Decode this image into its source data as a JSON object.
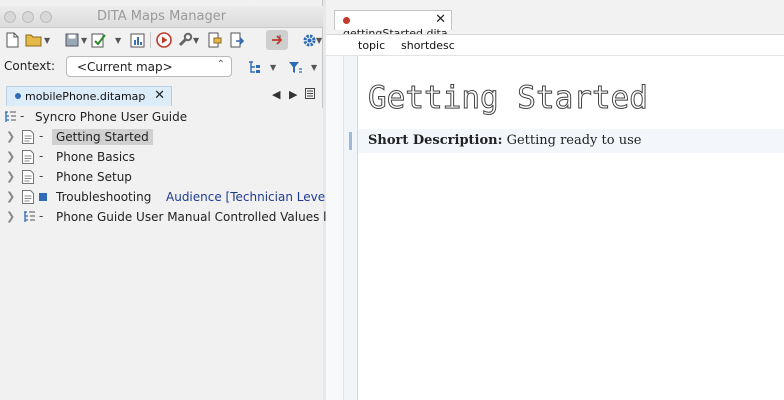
{
  "window": {
    "title": "DITA Maps Manager"
  },
  "context": {
    "label": "Context:",
    "value": "<Current map>"
  },
  "map_tab": {
    "name": "mobilePhone.ditamap",
    "close": "✕"
  },
  "tree": {
    "root": "Syncro Phone User Guide",
    "items": [
      {
        "label": "Getting Started",
        "selected": true
      },
      {
        "label": "Phone Basics"
      },
      {
        "label": "Phone Setup"
      },
      {
        "label": "Troubleshooting",
        "audience": "Audience [Technician Level]"
      },
      {
        "label": "Phone Guide User Manual Controlled Values list"
      }
    ],
    "dash": "-"
  },
  "editor": {
    "tab_name": "gettingStarted.dita",
    "tab_close": "✕",
    "breadcrumb": [
      "topic",
      "shortdesc"
    ],
    "title": "Getting Started",
    "shortdesc_label": "Short Description:",
    "shortdesc_text": "Getting ready to use"
  },
  "colors": {
    "accent": "#2f6bb4",
    "modified_dot": "#c0392b",
    "audience": "#1f3a93"
  }
}
